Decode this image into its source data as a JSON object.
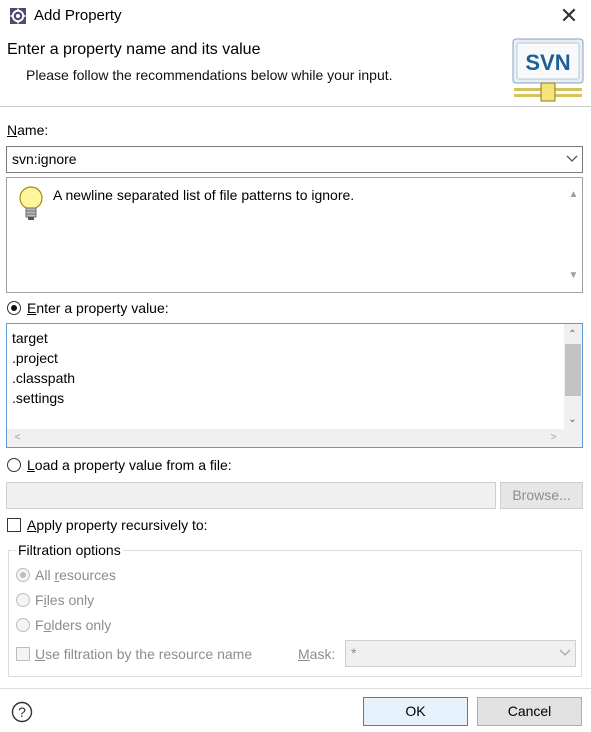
{
  "window": {
    "title": "Add Property",
    "close_glyph": "✕"
  },
  "banner": {
    "title": "Enter a property name and its value",
    "description": "Please follow the recommendations below while your input.",
    "logo_text": "SVN"
  },
  "name": {
    "label_mnemonic": "N",
    "label_rest": "ame:",
    "value": "svn:ignore"
  },
  "description_box": {
    "text": "A newline separated list of file patterns to ignore.",
    "icon": "lightbulb-icon"
  },
  "value_option": {
    "label_mnemonic": "E",
    "label_rest": "nter a property value:",
    "selected": true,
    "text": "target\n.project\n.classpath\n.settings"
  },
  "file_option": {
    "label_mnemonic": "L",
    "label_rest": "oad a property value from a file:",
    "selected": false,
    "path_value": "",
    "browse_label": "Browse..."
  },
  "recursive": {
    "label_mnemonic": "A",
    "label_rest": "pply property recursively to:",
    "checked": false
  },
  "filtration": {
    "title": "Filtration options",
    "options": [
      {
        "pre": "All ",
        "mnemonic": "r",
        "post": "esources",
        "selected": true
      },
      {
        "pre": "F",
        "mnemonic": "i",
        "post": "les only",
        "selected": false
      },
      {
        "pre": "F",
        "mnemonic": "o",
        "post": "lders only",
        "selected": false
      }
    ],
    "use_filter": {
      "pre": "",
      "mnemonic": "U",
      "post": "se filtration by the resource name"
    },
    "mask_label": {
      "mnemonic": "M",
      "post": "ask:"
    },
    "mask_value": "*"
  },
  "footer": {
    "ok_label": "OK",
    "cancel_label": "Cancel"
  },
  "colors": {
    "accent_border": "#5b9bd5",
    "ok_border": "#3c7fd1",
    "disabled_text": "#8d8d8d"
  }
}
